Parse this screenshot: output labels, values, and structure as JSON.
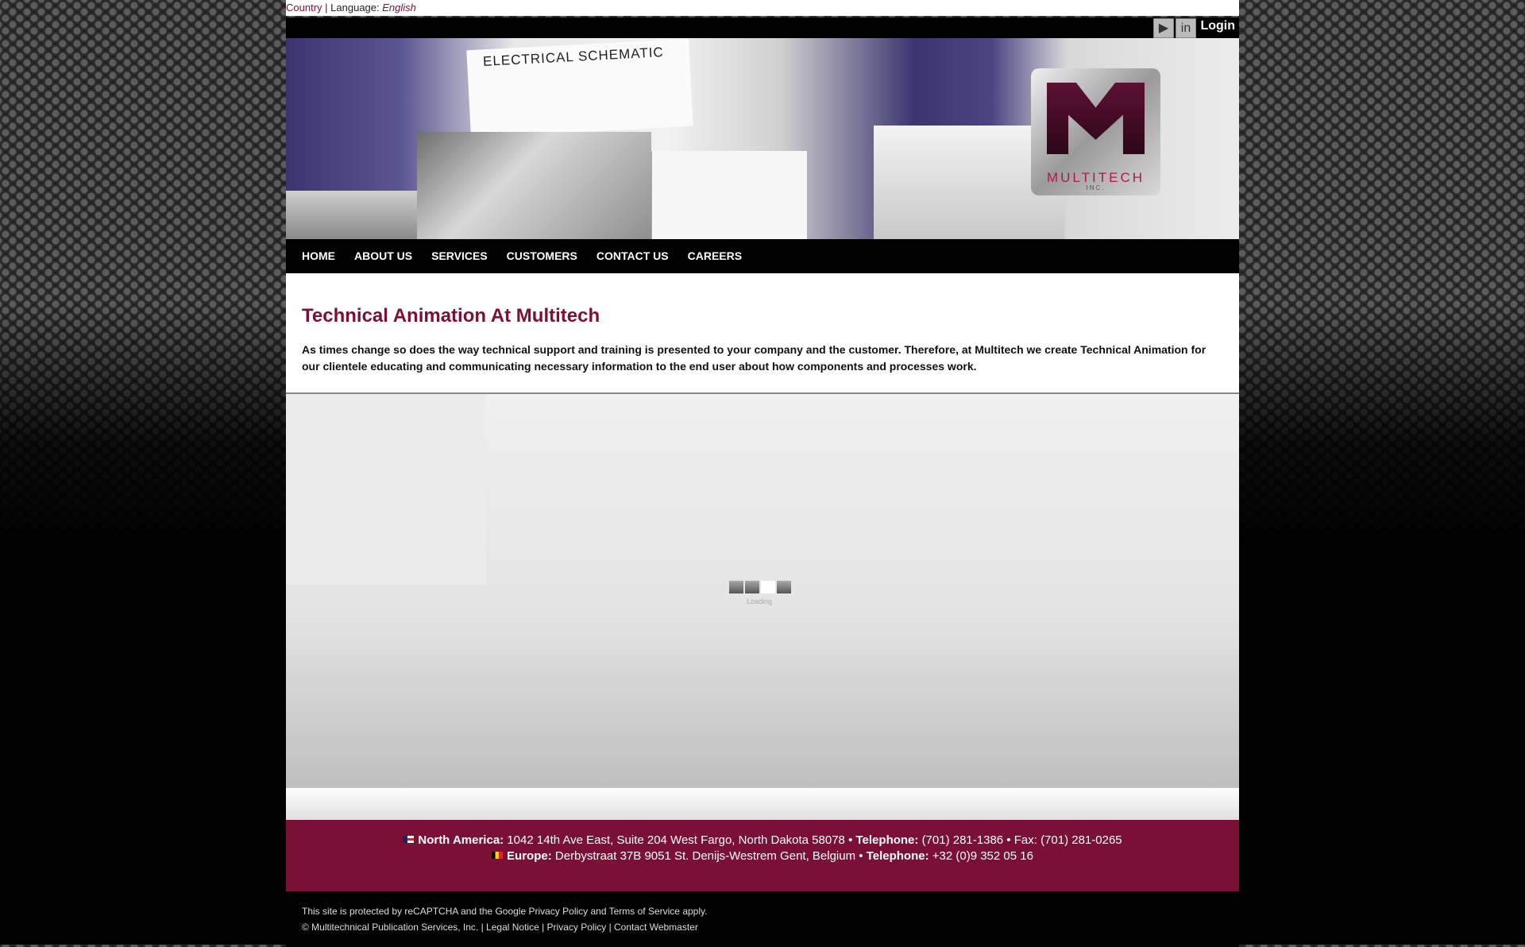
{
  "topbar": {
    "country": "Country",
    "sep": "|",
    "language_label": "Language:",
    "language_value": "English"
  },
  "header": {
    "login": "Login",
    "icons": [
      "youtube-icon",
      "linkedin-icon"
    ]
  },
  "banner": {
    "schematic_text": "ELECTRICAL SCHEMATIC",
    "logo_text": "MULTITECH",
    "logo_sub": "INC."
  },
  "nav": {
    "items": [
      "HOME",
      "ABOUT US",
      "SERVICES",
      "CUSTOMERS",
      "CONTACT US",
      "CAREERS"
    ]
  },
  "content": {
    "title": "Technical Animation At Multitech",
    "body": "As times change so does the way technical support and training is presented to your company and the customer. Therefore, at Multitech we create Technical Animation for our clientele educating and communicating necessary information to the end user about how components and processes work."
  },
  "player": {
    "loading": "Loading"
  },
  "address": {
    "na_label": "North America:",
    "na_address": "1042 14th Ave East, Suite 204 West Fargo, North Dakota 58078 •",
    "na_tel_label": "Telephone:",
    "na_tel": "(701) 281-1386 • Fax: (701) 281-0265",
    "eu_label": "Europe:",
    "eu_address": "Derbystraat 37B 9051 St. Denijs-Westrem Gent, Belgium •",
    "eu_tel_label": "Telephone:",
    "eu_tel": "+32 (0)9 352 05 16"
  },
  "footer": {
    "recaptcha": "This site is protected by reCAPTCHA and the Google Privacy Policy and Terms of Service apply.",
    "copyright": "© Multitechnical Publication Services, Inc. | Legal Notice | Privacy Policy | Contact Webmaster"
  },
  "colors": {
    "brand": "#7a1035"
  }
}
